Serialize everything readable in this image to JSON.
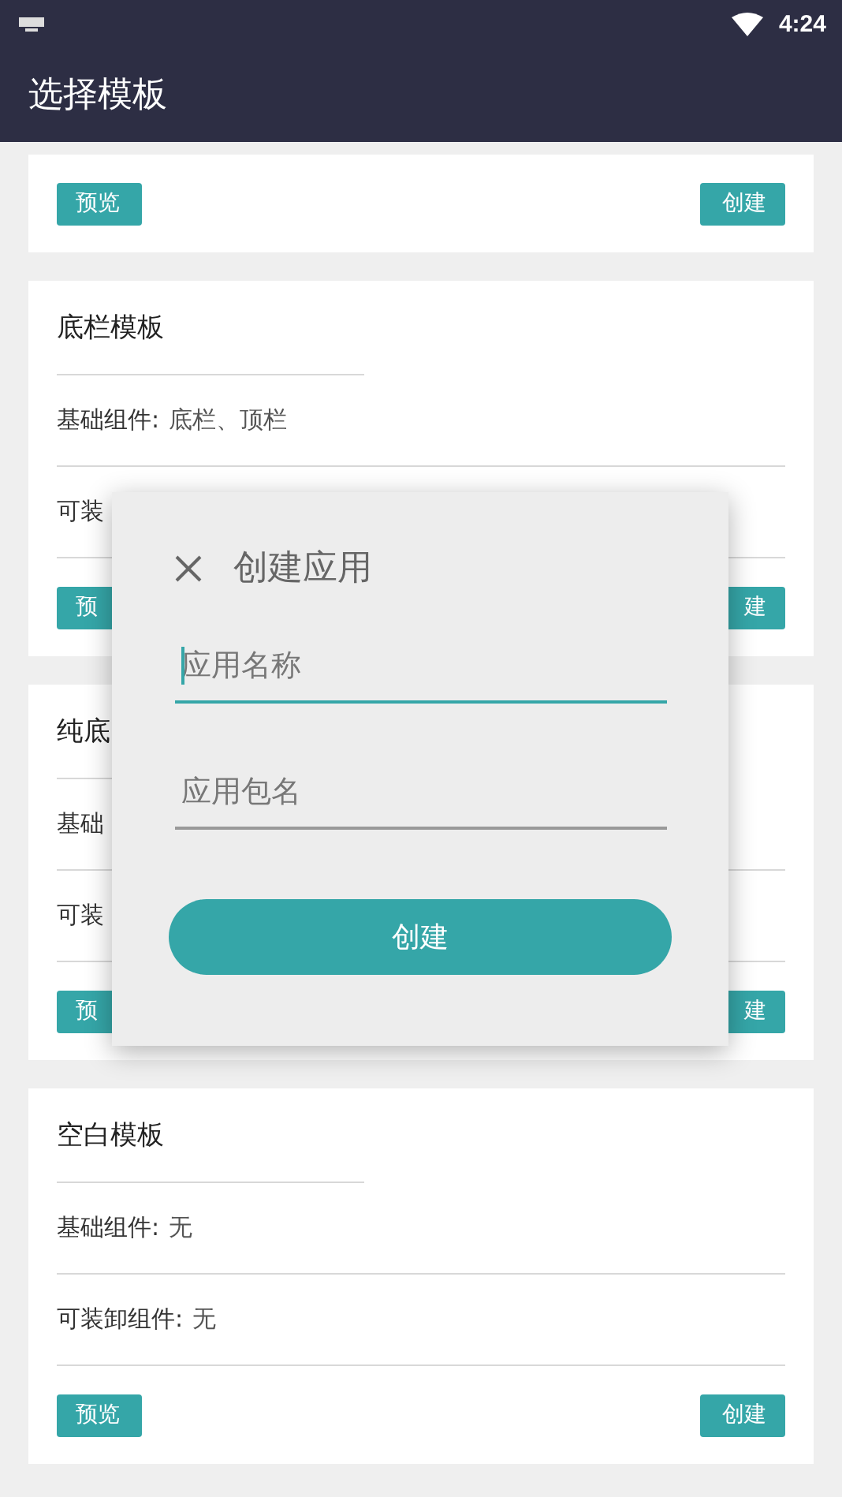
{
  "status_bar": {
    "time": "4:24"
  },
  "app_bar": {
    "title": "选择模板"
  },
  "cards": [
    {
      "buttons": [
        {
          "label": "预览",
          "kind": "preview"
        },
        {
          "label": "创建",
          "kind": "create"
        }
      ]
    },
    {
      "title": "底栏模板",
      "rows": [
        {
          "label": "基础组件:",
          "value": "底栏、顶栏"
        },
        {
          "label": "可装"
        }
      ],
      "buttons": [
        {
          "label": "预",
          "kind": "preview"
        },
        {
          "label": "建",
          "kind": "create"
        }
      ]
    },
    {
      "title": "纯底",
      "rows": [
        {
          "label": "基础"
        },
        {
          "label": "可装"
        }
      ],
      "buttons": [
        {
          "label": "预",
          "kind": "preview"
        },
        {
          "label": "建",
          "kind": "create"
        }
      ]
    },
    {
      "title": "空白模板",
      "rows": [
        {
          "label": "基础组件:",
          "value": "无"
        },
        {
          "label": "可装卸组件:",
          "value": "无"
        }
      ],
      "buttons": [
        {
          "label": "预览",
          "kind": "preview"
        },
        {
          "label": "创建",
          "kind": "create"
        }
      ]
    }
  ],
  "dialog": {
    "title": "创建应用",
    "fields": [
      {
        "placeholder": "应用名称",
        "focused": true
      },
      {
        "placeholder": "应用包名",
        "focused": false
      }
    ],
    "button": "创建"
  }
}
